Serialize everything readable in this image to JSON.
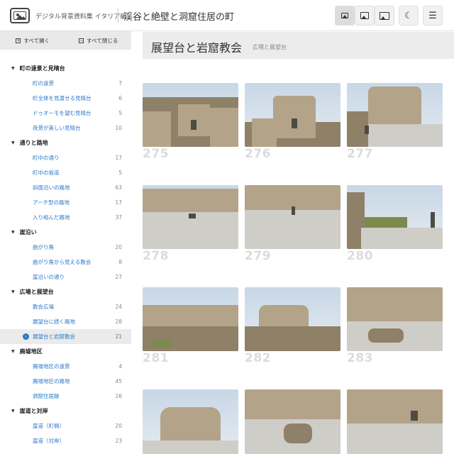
{
  "header": {
    "site_name": "デジタル背景資料集 イタリア編",
    "title": "渓谷と絶壁と洞窟住居の町",
    "buttons": [
      {
        "icon": "image-small-icon",
        "active": true
      },
      {
        "icon": "image-medium-icon",
        "active": false
      },
      {
        "icon": "image-large-icon",
        "active": false
      },
      {
        "icon": "moon-icon",
        "active": false
      },
      {
        "icon": "menu-icon",
        "active": false
      }
    ]
  },
  "sidebar": {
    "expand_all": "すべて開く",
    "collapse_all": "すべて閉じる",
    "categories": [
      {
        "label": "町の遠景と見晴台",
        "items": [
          {
            "label": "町の遠景",
            "count": "7"
          },
          {
            "label": "町全体を見渡せる見晴台",
            "count": "6"
          },
          {
            "label": "ドゥオーモを望む見晴台",
            "count": "5"
          },
          {
            "label": "夜景が美しい見晴台",
            "count": "10"
          }
        ]
      },
      {
        "label": "通りと路地",
        "items": [
          {
            "label": "町中の通り",
            "count": "17"
          },
          {
            "label": "町中の坂道",
            "count": "5"
          },
          {
            "label": "斜面沿いの路地",
            "count": "63"
          },
          {
            "label": "アーチ型の路地",
            "count": "17"
          },
          {
            "label": "入り組んだ路地",
            "count": "37"
          }
        ]
      },
      {
        "label": "崖沿い",
        "items": [
          {
            "label": "曲がり角",
            "count": "20"
          },
          {
            "label": "曲がり角から見える教会",
            "count": "8"
          },
          {
            "label": "崖沿いの通り",
            "count": "27"
          }
        ]
      },
      {
        "label": "広場と展望台",
        "items": [
          {
            "label": "教会広場",
            "count": "24"
          },
          {
            "label": "展望台に続く路地",
            "count": "28"
          },
          {
            "label": "展望台と岩窟教会",
            "count": "21",
            "selected": true
          }
        ]
      },
      {
        "label": "廃墟地区",
        "items": [
          {
            "label": "廃墟地区の遠景",
            "count": "4"
          },
          {
            "label": "廃墟地区の路地",
            "count": "45"
          },
          {
            "label": "洞窟住居跡",
            "count": "26"
          }
        ]
      },
      {
        "label": "崖道と対岸",
        "items": [
          {
            "label": "崖道（町側）",
            "count": "20"
          },
          {
            "label": "崖道（対岸）",
            "count": "23"
          }
        ]
      }
    ]
  },
  "main": {
    "title": "展望台と岩窟教会",
    "subtitle": "広場と展望台",
    "photos": [
      "275",
      "276",
      "277",
      "278",
      "279",
      "280",
      "281",
      "282",
      "283",
      "",
      "",
      ""
    ]
  }
}
